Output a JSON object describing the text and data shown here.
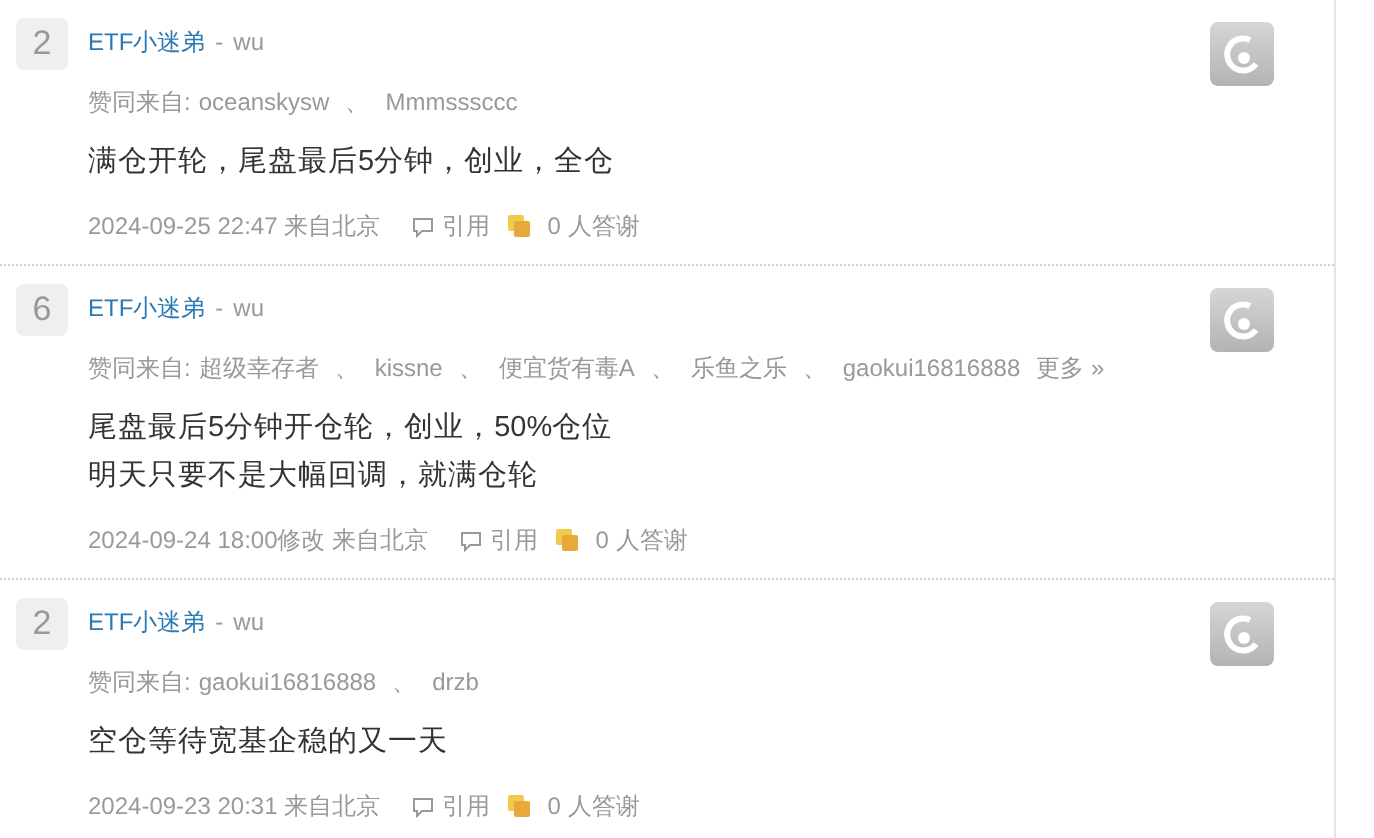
{
  "posts": [
    {
      "votes": "2",
      "author": "ETF小迷弟",
      "separator": "-",
      "user": "wu",
      "likes_label": "赞同来自:",
      "likers": [
        "oceanskysw",
        "Mmmsssccc"
      ],
      "content": [
        "满仓开轮，尾盘最后5分钟，创业，全仓"
      ],
      "time": "2024-09-25 22:47",
      "location": "来自北京",
      "quote": "引用",
      "thanks": "0 人答谢"
    },
    {
      "votes": "6",
      "author": "ETF小迷弟",
      "separator": "-",
      "user": "wu",
      "likes_label": "赞同来自:",
      "likers": [
        "超级幸存者",
        "kissne",
        "便宜货有毒A",
        "乐鱼之乐",
        "gaokui16816888"
      ],
      "more": "更多 »",
      "content": [
        "尾盘最后5分钟开仓轮，创业，50%仓位",
        "明天只要不是大幅回调，就满仓轮"
      ],
      "time": "2024-09-24 18:00修改",
      "location": "来自北京",
      "quote": "引用",
      "thanks": "0 人答谢"
    },
    {
      "votes": "2",
      "author": "ETF小迷弟",
      "separator": "-",
      "user": "wu",
      "likes_label": "赞同来自:",
      "likers": [
        "gaokui16816888",
        "drzb"
      ],
      "content": [
        "空仓等待宽基企稳的又一天"
      ],
      "time": "2024-09-23 20:31",
      "location": "来自北京",
      "quote": "引用",
      "thanks": "0 人答谢"
    }
  ],
  "liker_separator": "、"
}
